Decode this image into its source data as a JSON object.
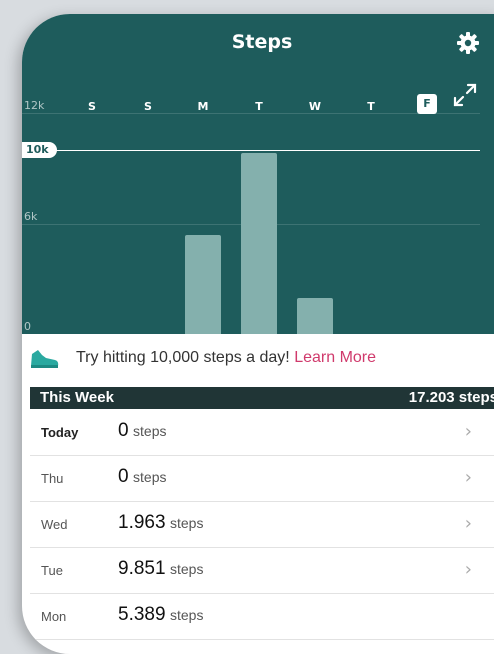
{
  "header": {
    "title": "Steps"
  },
  "chart_data": {
    "type": "bar",
    "categories": [
      "S",
      "S",
      "M",
      "T",
      "W",
      "T",
      "F"
    ],
    "values": [
      0,
      0,
      5389,
      9851,
      1963,
      0,
      0
    ],
    "selected_category_index": 6,
    "y_tick_labels": [
      "12k",
      "6k",
      "0"
    ],
    "y_ticks": [
      12000,
      6000,
      0
    ],
    "ylim": [
      0,
      12000
    ],
    "goal": 10000,
    "goal_label": "10k",
    "title": "",
    "xlabel": "",
    "ylabel": "",
    "grid": true
  },
  "tip": {
    "text": "Try hitting 10,000 steps a day!",
    "link": "Learn More"
  },
  "week": {
    "title": "This Week",
    "total": "17.203 steps"
  },
  "days": [
    {
      "day": "Today",
      "value": "0",
      "unit": "steps",
      "chevron": true
    },
    {
      "day": "Thu",
      "value": "0",
      "unit": "steps",
      "chevron": true
    },
    {
      "day": "Wed",
      "value": "1.963",
      "unit": "steps",
      "chevron": true
    },
    {
      "day": "Tue",
      "value": "9.851",
      "unit": "steps",
      "chevron": true
    },
    {
      "day": "Mon",
      "value": "5.389",
      "unit": "steps",
      "chevron": false
    }
  ],
  "colors": {
    "panel": "#1e5c5c",
    "bar": "#84b0ad",
    "link": "#d03a6c",
    "icon_accent": "#2aa9a0",
    "week_header": "#203536"
  },
  "icons": {
    "settings": "gear-icon",
    "expand": "expand-icon",
    "tip": "shoe-icon",
    "row": "chevron-right-icon"
  }
}
